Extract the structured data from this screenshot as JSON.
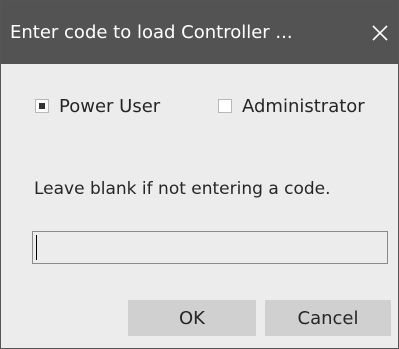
{
  "dialog": {
    "title": "Enter code to load Controller ...",
    "close_icon": "close-icon"
  },
  "options": {
    "power_user": {
      "label": "Power User",
      "checked": true
    },
    "administrator": {
      "label": "Administrator",
      "checked": false
    }
  },
  "info": {
    "text": "Leave blank if not entering a code."
  },
  "code_input": {
    "value": "",
    "placeholder": ""
  },
  "buttons": {
    "ok_label": "OK",
    "cancel_label": "Cancel"
  },
  "colors": {
    "titlebar": "#535353",
    "background": "#ececec",
    "button": "#d0d0d0"
  }
}
